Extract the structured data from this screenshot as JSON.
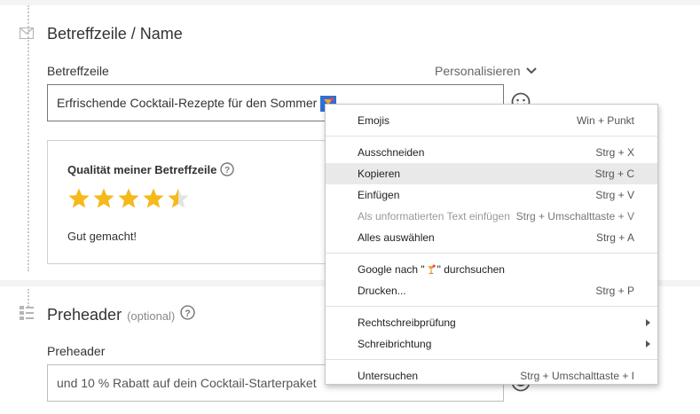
{
  "subject_section": {
    "title": "Betreffzeile / Name",
    "icon": "mail-icon",
    "field_label": "Betreffzeile",
    "personalize_label": "Personalisieren",
    "input_value": "Erfrischende Cocktail-Rezepte für den Sommer",
    "input_emoji": "tropical-drink-emoji",
    "quality": {
      "title": "Qualität meiner Betreffzeile",
      "rating": 4.5,
      "max_rating": 5,
      "feedback": "Gut gemacht!"
    }
  },
  "preheader_section": {
    "title": "Preheader",
    "optional_label": "(optional)",
    "icon": "layout-grid-icon",
    "field_label": "Preheader",
    "input_value": "und 10 % Rabatt auf dein Cocktail-Starterpaket"
  },
  "context_menu": {
    "groups": [
      [
        {
          "label": "Emojis",
          "shortcut": "Win + Punkt"
        }
      ],
      [
        {
          "label": "Ausschneiden",
          "shortcut": "Strg + X"
        },
        {
          "label": "Kopieren",
          "shortcut": "Strg + C",
          "state": "hover"
        },
        {
          "label": "Einfügen",
          "shortcut": "Strg + V"
        },
        {
          "label": "Als unformatierten Text einfügen",
          "shortcut": "Strg + Umschalttaste + V",
          "state": "disabled"
        },
        {
          "label": "Alles auswählen",
          "shortcut": "Strg + A"
        }
      ],
      [
        {
          "label_prefix": "Google nach \"",
          "label_suffix": "\" durchsuchen",
          "emoji": "tropical-drink-emoji",
          "shortcut": ""
        },
        {
          "label": "Drucken...",
          "shortcut": "Strg + P"
        }
      ],
      [
        {
          "label": "Rechtschreibprüfung",
          "submenu": true
        },
        {
          "label": "Schreibrichtung",
          "submenu": true
        }
      ],
      [
        {
          "label": "Untersuchen",
          "shortcut": "Strg + Umschalttaste + I"
        }
      ]
    ]
  },
  "colors": {
    "star": "#f6b91a",
    "emoji_highlight": "#2f6fd6",
    "menu_hover": "#e9e9e9"
  }
}
